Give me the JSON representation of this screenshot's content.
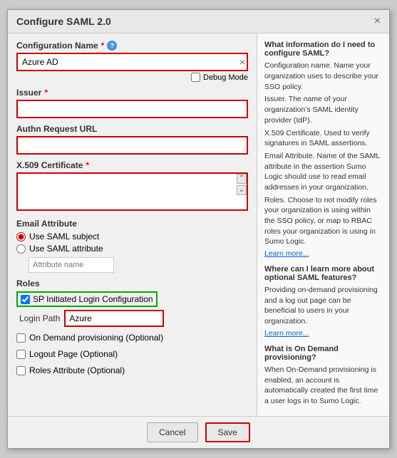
{
  "dialog": {
    "title": "Configure SAML 2.0",
    "close_label": "×"
  },
  "form": {
    "config_name_label": "Configuration Name",
    "config_name_value": "Azure AD",
    "debug_mode_label": "Debug Mode",
    "issuer_label": "Issuer",
    "authn_request_url_label": "Authn Request URL",
    "x509_cert_label": "X.509 Certificate",
    "email_attr_label": "Email Attribute",
    "use_saml_subject_label": "Use SAML subject",
    "use_saml_attribute_label": "Use SAML attribute",
    "attribute_name_placeholder": "Attribute name",
    "roles_label": "Roles",
    "sp_login_label": "SP Initiated Login Configuration",
    "login_path_label": "Login Path",
    "login_path_value": "Azure",
    "on_demand_label": "On Demand provisioning (Optional)",
    "logout_page_label": "Logout Page (Optional)",
    "roles_attr_label": "Roles Attribute (Optional)",
    "cancel_label": "Cancel",
    "save_label": "Save"
  },
  "help": {
    "section1_title": "What information do I need to configure SAML?",
    "config_name_help": "Configuration name. Name your organization uses to describe your SSO policy.",
    "issuer_help": "Issuer. The name of your organization's SAML identity provider (IdP).",
    "x509_help": "X.509 Certificate. Used to verify signatures in SAML assertions.",
    "email_help": "Email Attribute. Name of the SAML attribute in the assertion Sumo Logic should use to read email addresses in your organization.",
    "roles_help": "Roles. Choose to not modify roles your organization is using within the SSO policy, or map to RBAC roles your organization is using in Sumo Logic.",
    "learn_more1": "Learn more...",
    "section2_title": "Where can I learn more about optional SAML features?",
    "section2_text": "Providing on-demand provisioning and a log out page can be beneficial to users in your organization.",
    "learn_more2": "Learn more...",
    "section3_title": "What is On Demand provisioning?",
    "section3_text": "When On-Demand provisioning is enabled, an account is automatically created the first time a user logs in to Sumo Logic."
  }
}
